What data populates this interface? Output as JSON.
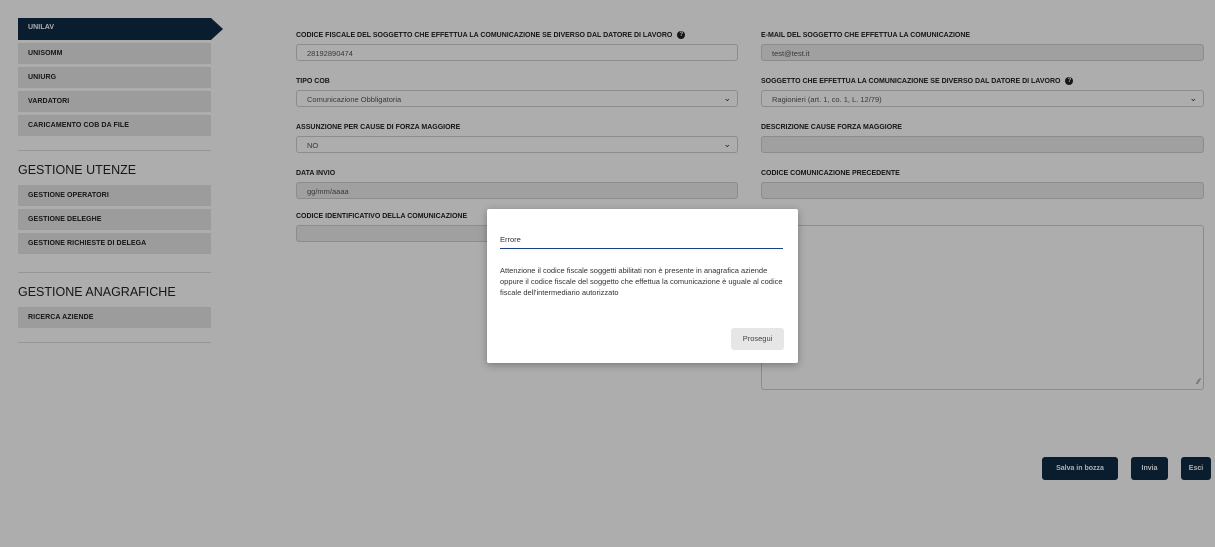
{
  "sidebar": {
    "items": [
      {
        "label": "UNILAV"
      },
      {
        "label": "UNISOMM"
      },
      {
        "label": "UNIURG"
      },
      {
        "label": "VARDATORI"
      },
      {
        "label": "CARICAMENTO COB DA FILE"
      }
    ],
    "sections": [
      {
        "heading": "GESTIONE UTENZE",
        "items": [
          {
            "label": "GESTIONE OPERATORI"
          },
          {
            "label": "GESTIONE DELEGHE"
          },
          {
            "label": "GESTIONE RICHIESTE DI DELEGA"
          }
        ]
      },
      {
        "heading": "GESTIONE ANAGRAFICHE",
        "items": [
          {
            "label": "RICERCA AZIENDE"
          }
        ]
      }
    ]
  },
  "form": {
    "codice_fiscale": {
      "label": "CODICE FISCALE DEL SOGGETTO CHE EFFETTUA LA COMUNICAZIONE SE DIVERSO DAL DATORE DI LAVORO",
      "value": "28192890474"
    },
    "email": {
      "label": "E-MAIL DEL SOGGETTO CHE EFFETTUA LA COMUNICAZIONE",
      "value": "test@test.it"
    },
    "tipo_cob": {
      "label": "TIPO COB",
      "value": "Comunicazione Obbligatoria"
    },
    "soggetto": {
      "label": "SOGGETTO CHE EFFETTUA LA COMUNICAZIONE SE DIVERSO DAL DATORE DI LAVORO",
      "value": "Ragionieri (art. 1, co. 1, L. 12/79)"
    },
    "assunzione": {
      "label": "ASSUNZIONE PER CAUSE DI FORZA MAGGIORE",
      "value": "NO"
    },
    "descrizione": {
      "label": "DESCRIZIONE CAUSE FORZA MAGGIORE",
      "value": ""
    },
    "data_invio": {
      "label": "DATA INVIO",
      "value": "gg/mm/aaaa"
    },
    "codice_precedente": {
      "label": "CODICE COMUNICAZIONE PRECEDENTE",
      "value": ""
    },
    "codice_identificativo": {
      "label": "CODICE IDENTIFICATIVO DELLA COMUNICAZIONE",
      "value": ""
    }
  },
  "buttons": {
    "salva": "Salva in bozza",
    "invia": "Invia",
    "esci": "Esci"
  },
  "dialog": {
    "title": "Errore",
    "message": "Attenzione il codice fiscale soggetti abilitati non è presente in anagrafica aziende oppure il codice fiscale del soggetto che effettua la comunicazione è uguale al codice fiscale dell'intermediario autorizzato",
    "button": "Prosegui"
  },
  "colors": {
    "primary": "#0f2b46",
    "overlay": "rgba(0,0,0,0.32)",
    "dialog_underline": "#1d3f88"
  }
}
